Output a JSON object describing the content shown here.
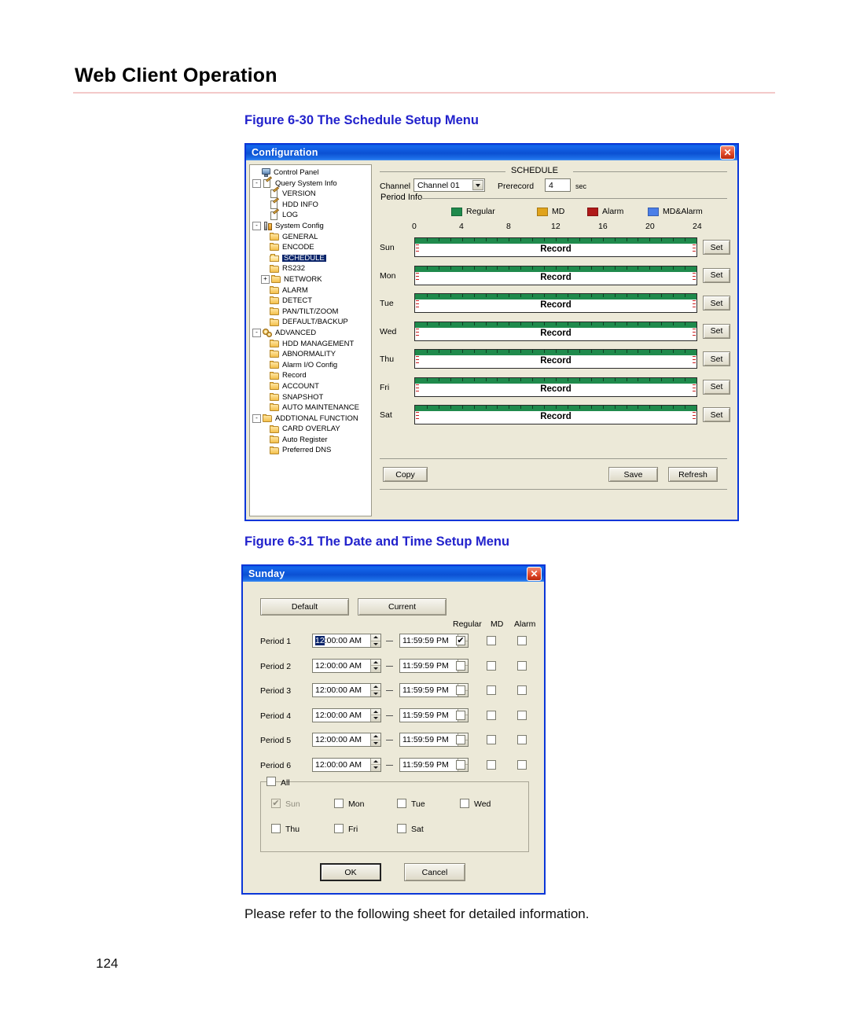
{
  "page": {
    "header_title": "Web Client Operation",
    "figure_30_caption": "Figure 6-30 The Schedule Setup Menu",
    "figure_31_caption": "Figure 6-31 The Date and Time Setup Menu",
    "body_text": "Please refer to the following sheet for detailed information.",
    "page_number": "124"
  },
  "colors": {
    "titlebar_blue": "#0b50d2",
    "caption_blue": "#2222cc",
    "dialog_face": "#ece9d8",
    "regular_green": "#1f8a4c",
    "md_orange": "#e0a31c",
    "alarm_red": "#b01a1a",
    "mdalarm_blue": "#4a7ee8",
    "selection_blue": "#0a246a"
  },
  "config_dialog": {
    "title": "Configuration",
    "close_label": "✕",
    "tree": [
      {
        "label": "Control Panel",
        "depth": 0,
        "icon": "monitor-icon",
        "expander": "",
        "selected": false
      },
      {
        "label": "Query System Info",
        "depth": 0,
        "icon": "note-icon",
        "expander": "-",
        "selected": false
      },
      {
        "label": "VERSION",
        "depth": 1,
        "icon": "note-icon",
        "expander": "",
        "selected": false
      },
      {
        "label": "HDD INFO",
        "depth": 1,
        "icon": "note-icon",
        "expander": "",
        "selected": false
      },
      {
        "label": "LOG",
        "depth": 1,
        "icon": "note-icon",
        "expander": "",
        "selected": false
      },
      {
        "label": "System Config",
        "depth": 0,
        "icon": "tool-icon",
        "expander": "-",
        "selected": false
      },
      {
        "label": "GENERAL",
        "depth": 1,
        "icon": "folder-icon",
        "expander": "",
        "selected": false
      },
      {
        "label": "ENCODE",
        "depth": 1,
        "icon": "folder-icon",
        "expander": "",
        "selected": false
      },
      {
        "label": "SCHEDULE",
        "depth": 1,
        "icon": "folder-open-icon",
        "expander": "",
        "selected": true
      },
      {
        "label": "RS232",
        "depth": 1,
        "icon": "folder-icon",
        "expander": "",
        "selected": false
      },
      {
        "label": "NETWORK",
        "depth": 1,
        "icon": "folder-icon",
        "expander": "+",
        "selected": false
      },
      {
        "label": "ALARM",
        "depth": 1,
        "icon": "folder-icon",
        "expander": "",
        "selected": false
      },
      {
        "label": "DETECT",
        "depth": 1,
        "icon": "folder-icon",
        "expander": "",
        "selected": false
      },
      {
        "label": "PAN/TILT/ZOOM",
        "depth": 1,
        "icon": "folder-icon",
        "expander": "",
        "selected": false
      },
      {
        "label": "DEFAULT/BACKUP",
        "depth": 1,
        "icon": "folder-icon",
        "expander": "",
        "selected": false
      },
      {
        "label": "ADVANCED",
        "depth": 0,
        "icon": "gears-icon",
        "expander": "-",
        "selected": false
      },
      {
        "label": "HDD MANAGEMENT",
        "depth": 1,
        "icon": "folder-icon",
        "expander": "",
        "selected": false
      },
      {
        "label": "ABNORMALITY",
        "depth": 1,
        "icon": "folder-icon",
        "expander": "",
        "selected": false
      },
      {
        "label": "Alarm I/O Config",
        "depth": 1,
        "icon": "folder-icon",
        "expander": "",
        "selected": false
      },
      {
        "label": "Record",
        "depth": 1,
        "icon": "folder-icon",
        "expander": "",
        "selected": false
      },
      {
        "label": "ACCOUNT",
        "depth": 1,
        "icon": "folder-icon",
        "expander": "",
        "selected": false
      },
      {
        "label": "SNAPSHOT",
        "depth": 1,
        "icon": "folder-icon",
        "expander": "",
        "selected": false
      },
      {
        "label": "AUTO MAINTENANCE",
        "depth": 1,
        "icon": "folder-icon",
        "expander": "",
        "selected": false
      },
      {
        "label": "ADDTIONAL FUNCTION",
        "depth": 0,
        "icon": "folder-icon",
        "expander": "-",
        "selected": false
      },
      {
        "label": "CARD OVERLAY",
        "depth": 1,
        "icon": "folder-icon",
        "expander": "",
        "selected": false
      },
      {
        "label": "Auto Register",
        "depth": 1,
        "icon": "folder-icon",
        "expander": "",
        "selected": false
      },
      {
        "label": "Preferred DNS",
        "depth": 1,
        "icon": "folder-icon",
        "expander": "",
        "selected": false
      }
    ],
    "schedule": {
      "group_title": "SCHEDULE",
      "channel_label": "Channel",
      "channel_value": "Channel 01",
      "prerecord_label": "Prerecord",
      "prerecord_value": "4",
      "prerecord_unit": "sec",
      "period_info_label": "Period Info",
      "legend": [
        {
          "label": "Regular",
          "color": "#1f8a4c"
        },
        {
          "label": "MD",
          "color": "#e0a31c"
        },
        {
          "label": "Alarm",
          "color": "#b01a1a"
        },
        {
          "label": "MD&Alarm",
          "color": "#4a7ee8"
        }
      ],
      "axis_ticks": [
        "0",
        "4",
        "8",
        "12",
        "16",
        "20",
        "24"
      ],
      "rows": [
        {
          "day": "Sun",
          "record_label": "Record",
          "set_label": "Set",
          "type": "Regular"
        },
        {
          "day": "Mon",
          "record_label": "Record",
          "set_label": "Set",
          "type": "Regular"
        },
        {
          "day": "Tue",
          "record_label": "Record",
          "set_label": "Set",
          "type": "Regular"
        },
        {
          "day": "Wed",
          "record_label": "Record",
          "set_label": "Set",
          "type": "Regular"
        },
        {
          "day": "Thu",
          "record_label": "Record",
          "set_label": "Set",
          "type": "Regular"
        },
        {
          "day": "Fri",
          "record_label": "Record",
          "set_label": "Set",
          "type": "Regular"
        },
        {
          "day": "Sat",
          "record_label": "Record",
          "set_label": "Set",
          "type": "Regular"
        }
      ],
      "copy_label": "Copy",
      "save_label": "Save",
      "refresh_label": "Refresh"
    }
  },
  "sunday_dialog": {
    "title": "Sunday",
    "close_label": "✕",
    "default_label": "Default",
    "current_label": "Current",
    "col_headers": [
      "Regular",
      "MD",
      "Alarm"
    ],
    "periods": [
      {
        "label": "Period 1",
        "start": "12:00:00 AM",
        "end": "11:59:59 PM",
        "regular": true,
        "md": false,
        "alarm": false,
        "start_selected_prefix": "12"
      },
      {
        "label": "Period 2",
        "start": "12:00:00 AM",
        "end": "11:59:59 PM",
        "regular": false,
        "md": false,
        "alarm": false,
        "start_selected_prefix": ""
      },
      {
        "label": "Period 3",
        "start": "12:00:00 AM",
        "end": "11:59:59 PM",
        "regular": false,
        "md": false,
        "alarm": false,
        "start_selected_prefix": ""
      },
      {
        "label": "Period 4",
        "start": "12:00:00 AM",
        "end": "11:59:59 PM",
        "regular": false,
        "md": false,
        "alarm": false,
        "start_selected_prefix": ""
      },
      {
        "label": "Period 5",
        "start": "12:00:00 AM",
        "end": "11:59:59 PM",
        "regular": false,
        "md": false,
        "alarm": false,
        "start_selected_prefix": ""
      },
      {
        "label": "Period 6",
        "start": "12:00:00 AM",
        "end": "11:59:59 PM",
        "regular": false,
        "md": false,
        "alarm": false,
        "start_selected_prefix": ""
      }
    ],
    "all_label": "All",
    "all_checked": false,
    "days": [
      {
        "label": "Sun",
        "checked": true,
        "disabled": true
      },
      {
        "label": "Mon",
        "checked": false,
        "disabled": false
      },
      {
        "label": "Tue",
        "checked": false,
        "disabled": false
      },
      {
        "label": "Wed",
        "checked": false,
        "disabled": false
      },
      {
        "label": "Thu",
        "checked": false,
        "disabled": false
      },
      {
        "label": "Fri",
        "checked": false,
        "disabled": false
      },
      {
        "label": "Sat",
        "checked": false,
        "disabled": false
      }
    ],
    "ok_label": "OK",
    "cancel_label": "Cancel"
  }
}
